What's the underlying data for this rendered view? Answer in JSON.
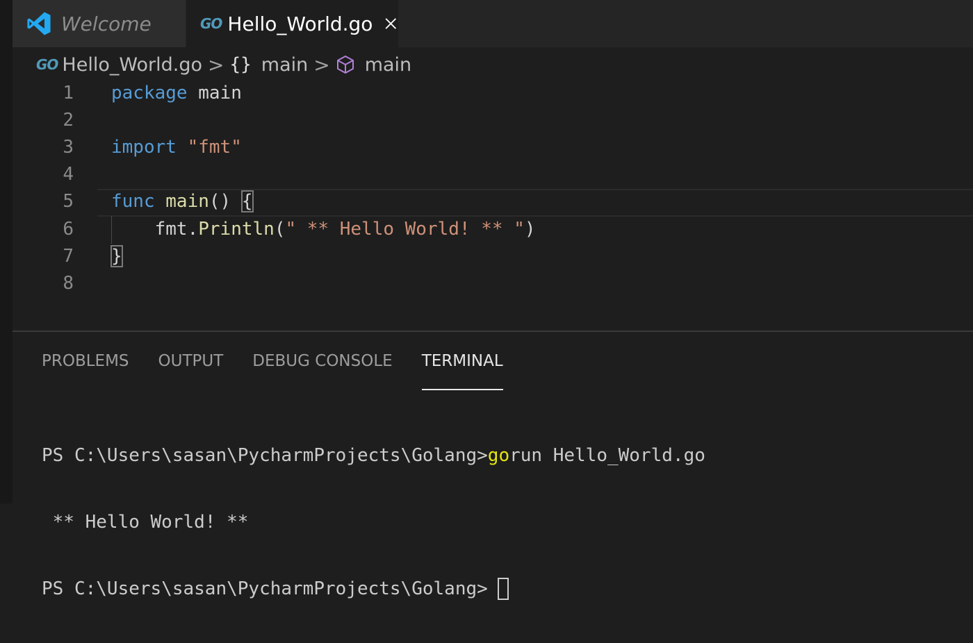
{
  "tabs": [
    {
      "label": "Welcome",
      "icon": "vscode-logo-icon",
      "active": false
    },
    {
      "label": "Hello_World.go",
      "icon": "go-file-icon",
      "active": true
    }
  ],
  "go_icon_text": "GO",
  "breadcrumb": {
    "file": "Hello_World.go",
    "package": "main",
    "function": "main",
    "separator": ">"
  },
  "editor": {
    "lines": [
      {
        "number": "1",
        "tokens": [
          {
            "t": "package",
            "c": "kw"
          },
          {
            "t": " main",
            "c": "plain"
          }
        ]
      },
      {
        "number": "2",
        "tokens": []
      },
      {
        "number": "3",
        "tokens": [
          {
            "t": "import",
            "c": "kw"
          },
          {
            "t": " ",
            "c": "plain"
          },
          {
            "t": "\"fmt\"",
            "c": "str"
          }
        ]
      },
      {
        "number": "4",
        "tokens": []
      },
      {
        "number": "5",
        "tokens": [
          {
            "t": "func",
            "c": "kw"
          },
          {
            "t": " ",
            "c": "plain"
          },
          {
            "t": "main",
            "c": "fn"
          },
          {
            "t": "() ",
            "c": "plain"
          },
          {
            "t": "{",
            "c": "plain bracket-box"
          }
        ]
      },
      {
        "number": "6",
        "tokens": [
          {
            "t": "    fmt.",
            "c": "plain"
          },
          {
            "t": "Println",
            "c": "fn"
          },
          {
            "t": "(",
            "c": "plain"
          },
          {
            "t": "\" ** Hello World! ** \"",
            "c": "str"
          },
          {
            "t": ")",
            "c": "plain"
          }
        ]
      },
      {
        "number": "7",
        "tokens": [
          {
            "t": "}",
            "c": "plain bracket-box"
          }
        ]
      },
      {
        "number": "8",
        "tokens": []
      }
    ]
  },
  "panel": {
    "tabs": [
      "PROBLEMS",
      "OUTPUT",
      "DEBUG CONSOLE",
      "TERMINAL"
    ],
    "active_tab": "TERMINAL"
  },
  "terminal": {
    "prompt": "PS C:\\Users\\sasan\\PycharmProjects\\Golang>",
    "command_go": "go",
    "command_rest": "run Hello_World.go",
    "output": " ** Hello World! **"
  },
  "colors": {
    "keyword": "#569cd6",
    "function": "#dcdcaa",
    "string": "#ce9178",
    "go_icon": "#519aba",
    "vscode_logo": "#23a9f2",
    "cube_icon": "#b180d7",
    "terminal_go": "#e5e510"
  }
}
